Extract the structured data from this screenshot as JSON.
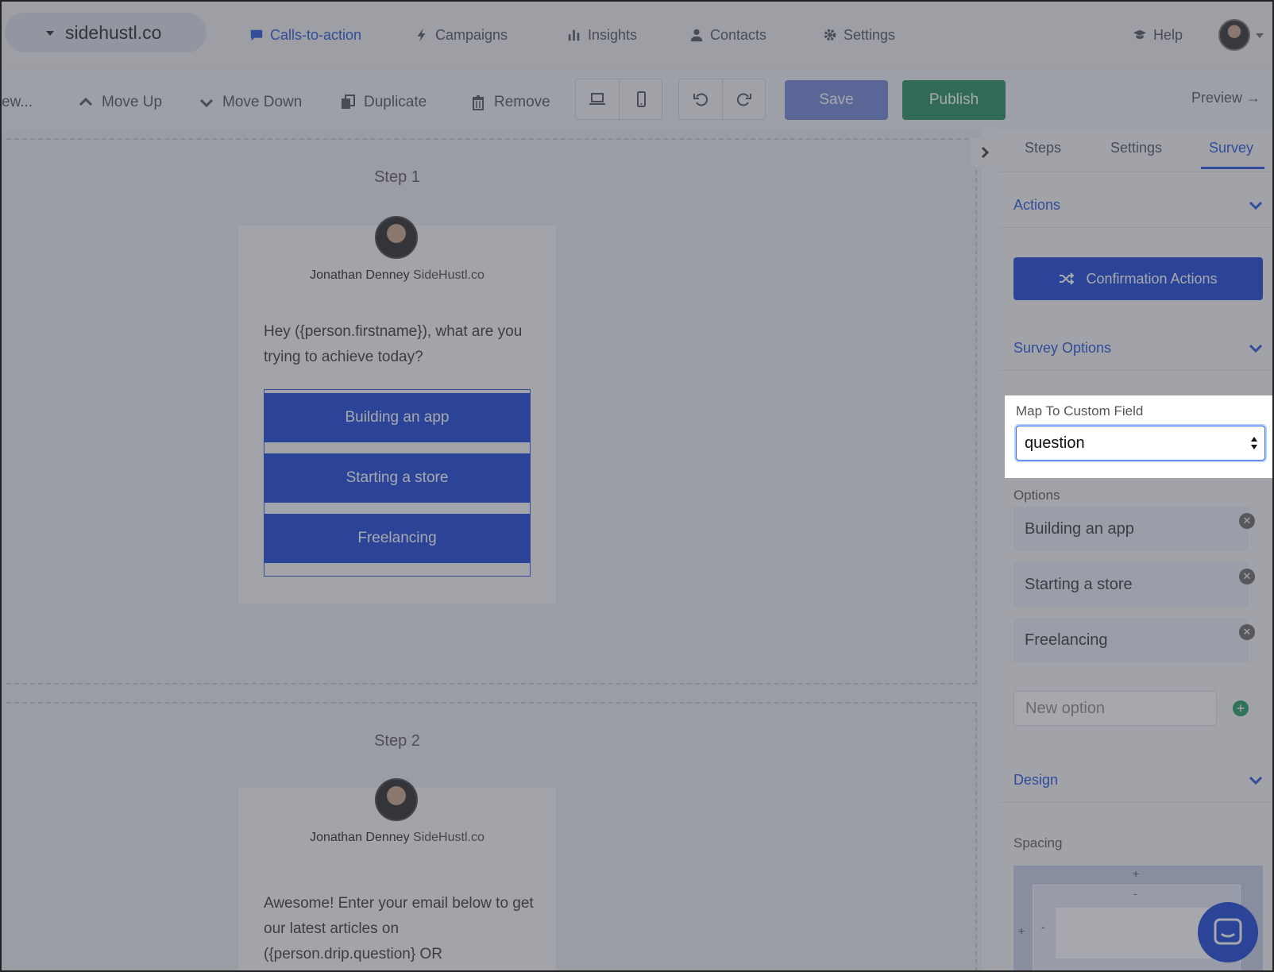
{
  "account": {
    "name": "sidehustl.co"
  },
  "nav": {
    "items": [
      {
        "label": "Calls-to-action",
        "icon": "chat-icon",
        "active": true
      },
      {
        "label": "Campaigns",
        "icon": "bolt-icon"
      },
      {
        "label": "Insights",
        "icon": "bar-chart-icon"
      },
      {
        "label": "Contacts",
        "icon": "person-icon"
      },
      {
        "label": "Settings",
        "icon": "gear-icon"
      }
    ],
    "help": "Help"
  },
  "toolbar": {
    "truncated": "ew...",
    "move_up": "Move Up",
    "move_down": "Move Down",
    "duplicate": "Duplicate",
    "remove": "Remove",
    "save": "Save",
    "publish": "Publish",
    "preview": "Preview →"
  },
  "steps": [
    {
      "label": "Step 1",
      "author": "Jonathan Denney",
      "company": "SideHustl.co",
      "question": "Hey ({person.firstname}), what are you trying to achieve today?",
      "options": [
        "Building an app",
        "Starting a store",
        "Freelancing"
      ]
    },
    {
      "label": "Step 2",
      "author": "Jonathan Denney",
      "company": "SideHustl.co",
      "question": "Awesome! Enter your email below to get our latest articles on ({person.drip.question} OR"
    }
  ],
  "sidebar": {
    "tabs": [
      "Steps",
      "Settings",
      "Survey"
    ],
    "active_tab": "Survey",
    "actions_title": "Actions",
    "confirmation_actions": "Confirmation Actions",
    "survey_options_title": "Survey Options",
    "map_label": "Map To Custom Field",
    "map_value": "question",
    "options_label": "Options",
    "options": [
      "Building an app",
      "Starting a store",
      "Freelancing"
    ],
    "new_option_placeholder": "New option",
    "design_title": "Design",
    "spacing_label": "Spacing"
  },
  "colors": {
    "accent": "#1f4fd6",
    "primary_button": "#1540d6",
    "publish": "#1f8a5c",
    "save": "#6c80d4"
  }
}
